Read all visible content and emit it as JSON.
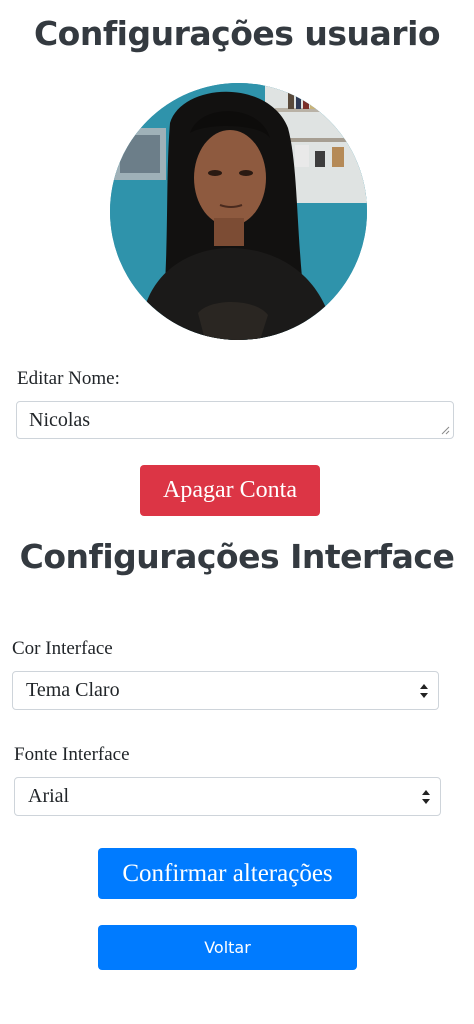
{
  "user_settings": {
    "title": "Configurações usuario",
    "edit_name_label": "Editar Nome:",
    "name_value": "Nicolas",
    "delete_account_label": "Apagar Conta"
  },
  "interface_settings": {
    "title": "Configurações Interface",
    "color_label": "Cor Interface",
    "color_selected": "Tema Claro",
    "font_label": "Fonte Interface",
    "font_selected": "Arial"
  },
  "actions": {
    "confirm_label": "Confirmar alterações",
    "back_label": "Voltar"
  },
  "icons": {
    "select_arrows": "chevron-up-down-icon",
    "resize_grip": "resize-grip-icon"
  },
  "colors": {
    "danger": "#dc3545",
    "primary": "#007bff",
    "heading": "#343a40"
  }
}
